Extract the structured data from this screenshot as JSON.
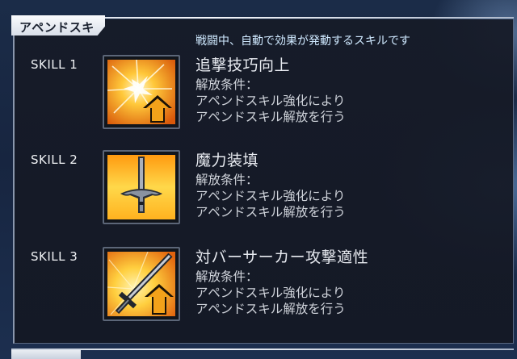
{
  "section": {
    "title": "アペンドスキル",
    "description": "戦闘中、自動で効果が発動するスキルです"
  },
  "skills": [
    {
      "label": "SKILL 1",
      "name": "追撃技巧向上",
      "condition_title": "解放条件：",
      "condition_line1": "アペンドスキル強化により",
      "condition_line2": "アペンドスキル解放を行う",
      "icon": "burst-upgrade-icon"
    },
    {
      "label": "SKILL 2",
      "name": "魔力装填",
      "condition_title": "解放条件：",
      "condition_line1": "アペンドスキル強化により",
      "condition_line2": "アペンドスキル解放を行う",
      "icon": "sword-icon"
    },
    {
      "label": "SKILL 3",
      "name": "対バーサーカー攻撃適性",
      "condition_title": "解放条件：",
      "condition_line1": "アペンドスキル強化により",
      "condition_line2": "アペンドスキル解放を行う",
      "icon": "sword-upgrade-icon"
    }
  ],
  "next_section": {
    "title": ""
  },
  "colors": {
    "panel_bg": "#161b28",
    "description_text": "#cfe9ff",
    "icon_orange": "#f29a16",
    "icon_yellow": "#ffe04a"
  }
}
